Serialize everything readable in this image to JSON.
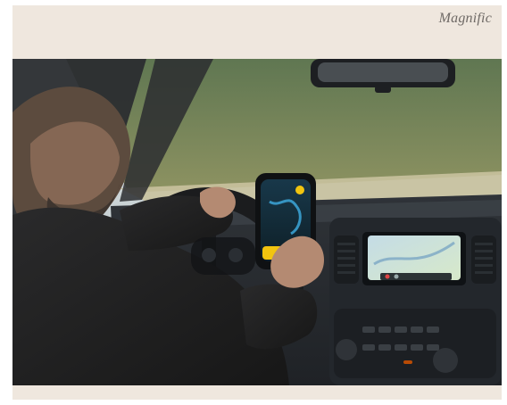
{
  "brand": {
    "text": "Magnific"
  },
  "photo": {
    "subject": "photo-driver-smartphone-navigation",
    "colors": {
      "background": "#efe7de",
      "brand_text": "#6f6a66",
      "phone_accent": "#f1c40f",
      "dashboard": "#23272c",
      "trees": "#4f6a3d"
    }
  }
}
